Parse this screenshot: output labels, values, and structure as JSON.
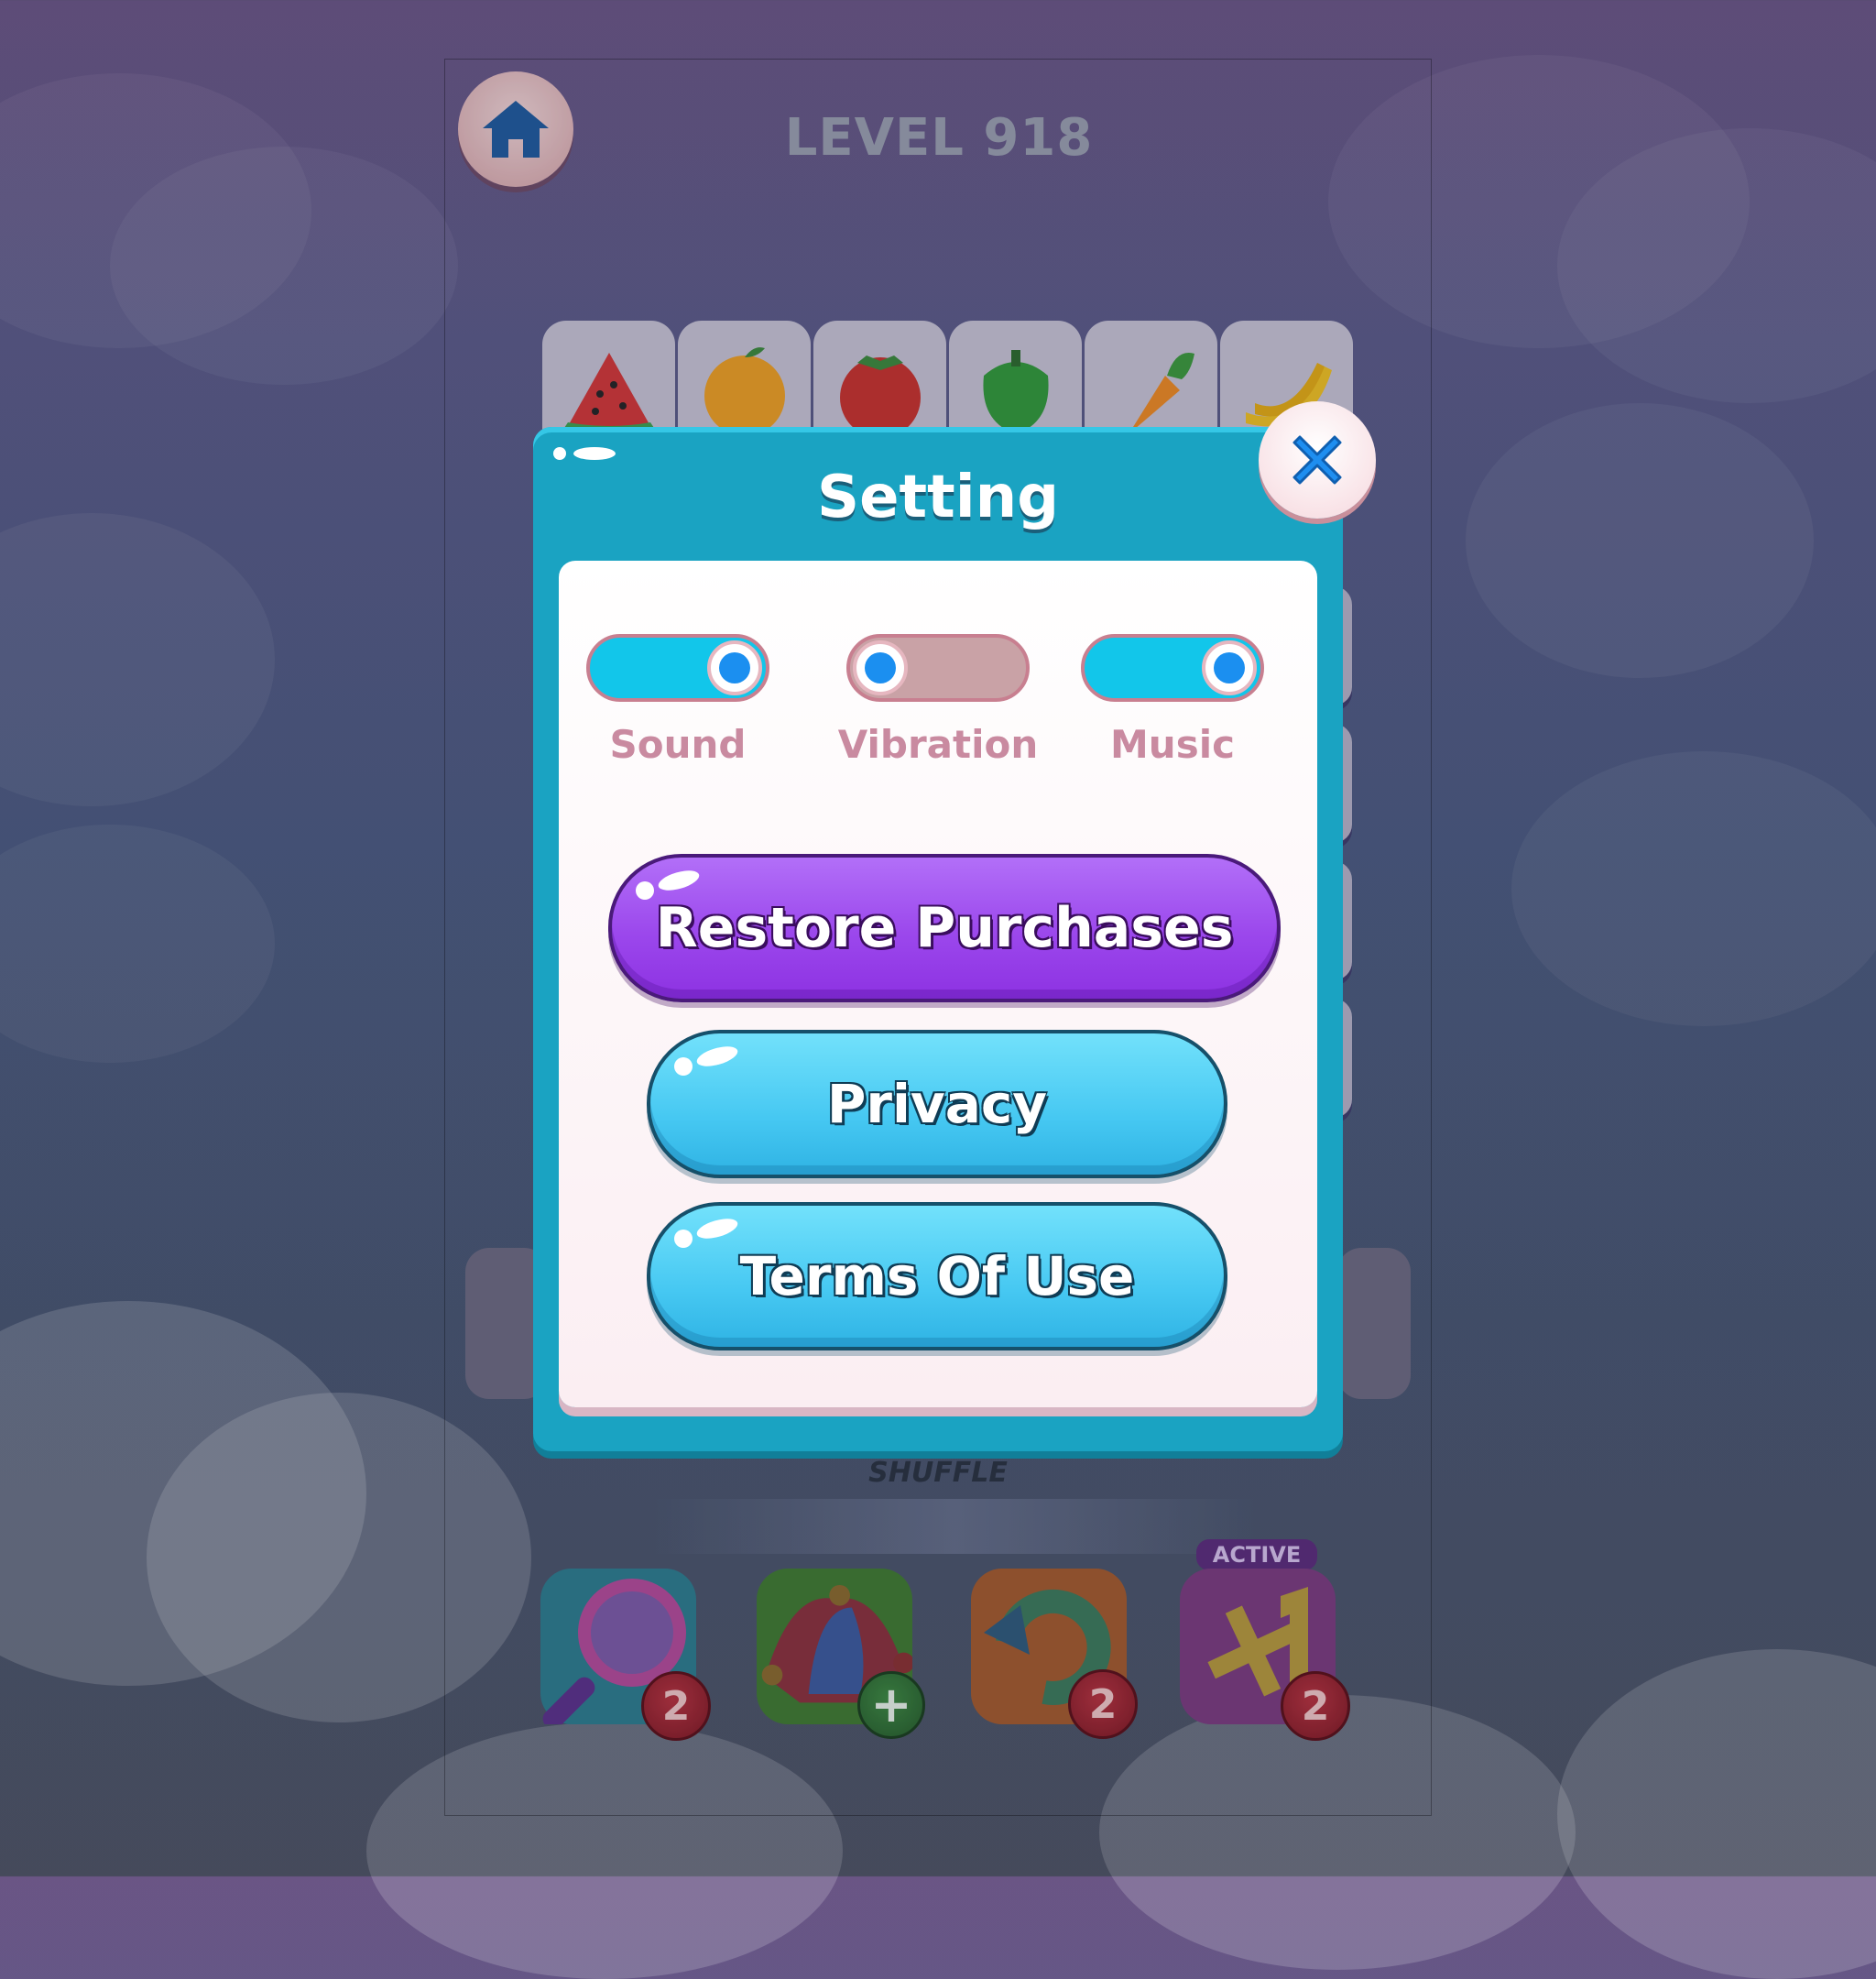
{
  "header": {
    "level_label": "LEVEL 918"
  },
  "board": {
    "top_tiles": [
      "watermelon-icon",
      "orange-icon",
      "tomato-icon",
      "green-pepper-icon",
      "carrot-icon",
      "banana-icon"
    ]
  },
  "shuffle": {
    "label": "SHUFFLE"
  },
  "boosters": [
    {
      "name": "magnifier-icon",
      "count": "2"
    },
    {
      "name": "jester-hat-icon",
      "count": "+"
    },
    {
      "name": "undo-arrow-icon",
      "count": "2"
    },
    {
      "name": "plus-one-icon",
      "count": "2",
      "tag": "ACTIVE"
    }
  ],
  "dialog": {
    "title": "Setting",
    "toggles": [
      {
        "label": "Sound",
        "state": "on"
      },
      {
        "label": "Vibration",
        "state": "off"
      },
      {
        "label": "Music",
        "state": "on"
      }
    ],
    "buttons": {
      "restore": "Restore Purchases",
      "privacy": "Privacy",
      "terms": "Terms Of Use"
    }
  },
  "colors": {
    "dialog_blue": "#1aa3c2",
    "toggle_on": "#12c6ea",
    "toggle_off": "#c9a2a6",
    "purple_button": "#9b47ec",
    "blue_button": "#46c8f2",
    "label_pink": "#c98aa0"
  }
}
